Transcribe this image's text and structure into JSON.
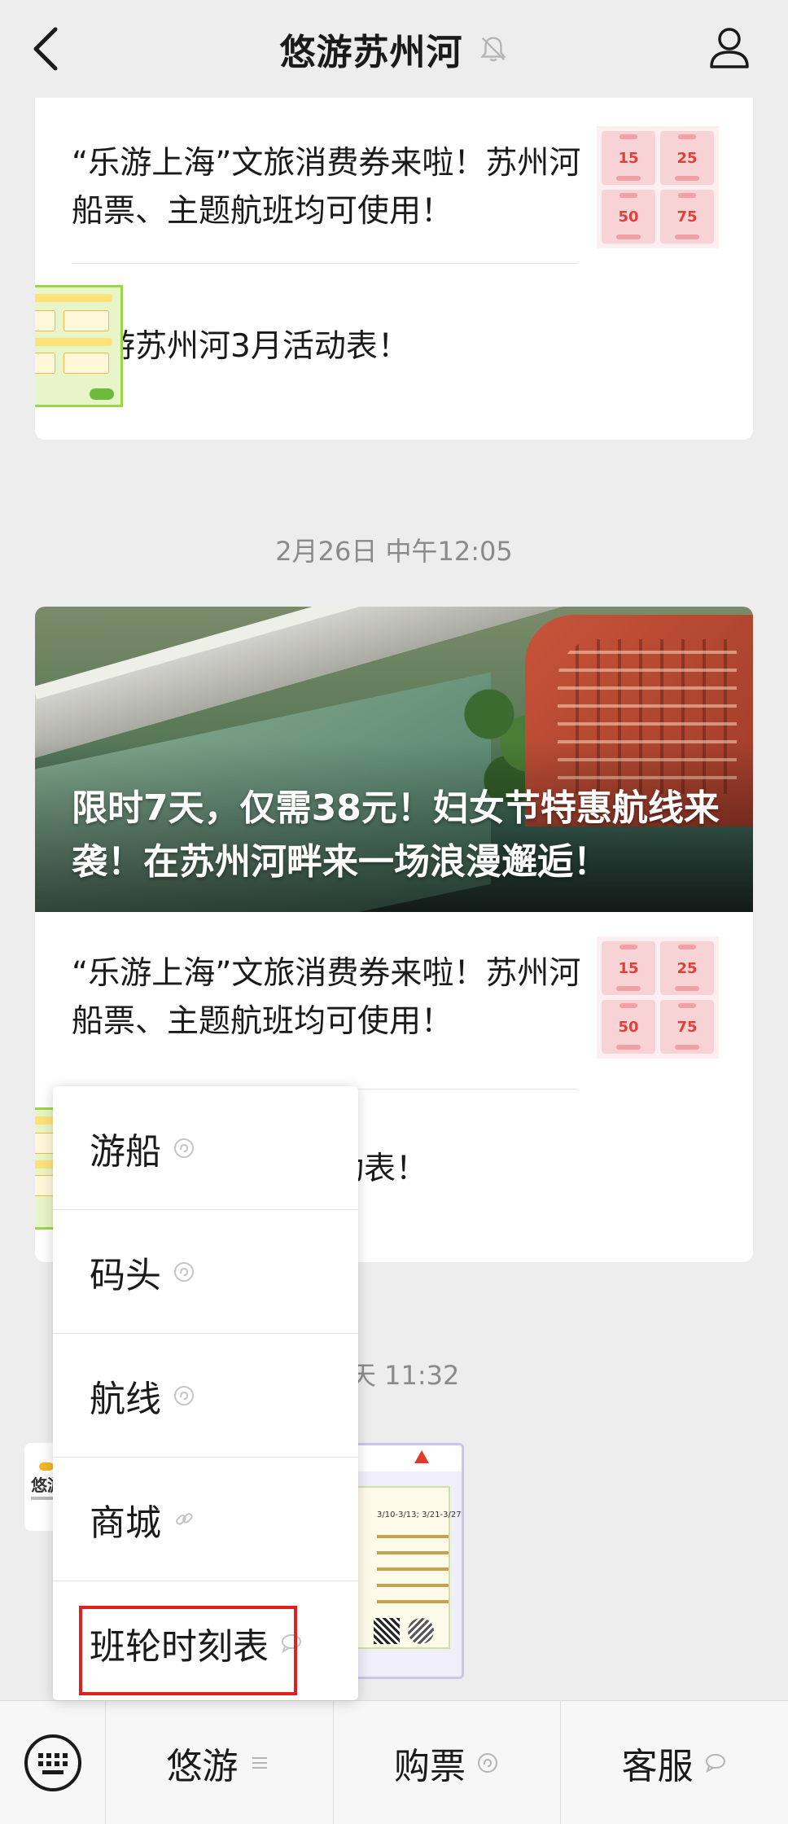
{
  "header": {
    "title": "悠游苏州河",
    "back_icon": "chevron-left-icon",
    "mute_icon": "bell-muted-icon",
    "profile_icon": "person-icon"
  },
  "article_group_1": {
    "items": [
      {
        "title": "“乐游上海”文旅消费券来啦！苏州河船票、主题航班均可使用！",
        "thumb": "coupon"
      },
      {
        "title": "悠游苏州河3月活动表！",
        "thumb": "schedule"
      }
    ]
  },
  "timestamp_1": "2月26日 中午12:05",
  "article_group_2": {
    "banner_title": "限时7天，仅需38元！妇女节特惠航线来袭！在苏州河畔来一场浪漫邂逅！",
    "items": [
      {
        "title": "“乐游上海”文旅消费券来啦！苏州河船票、主题航班均可使用！",
        "thumb": "coupon"
      },
      {
        "title_visible": "动表！",
        "thumb": "schedule"
      }
    ]
  },
  "timestamp_2_visible": "天 11:32",
  "coupon_values": [
    "15",
    "25",
    "50",
    "75"
  ],
  "image_message": {
    "visible_text": "3/10-3/13; 3/21-3/27"
  },
  "popup_menu": {
    "items": [
      {
        "label": "游船",
        "icon": "mini-program-icon"
      },
      {
        "label": "码头",
        "icon": "mini-program-icon"
      },
      {
        "label": "航线",
        "icon": "mini-program-icon"
      },
      {
        "label": "商城",
        "icon": "link-icon"
      },
      {
        "label": "班轮时刻表",
        "icon": "message-icon",
        "highlighted": true
      }
    ],
    "highlight_color": "#e02020"
  },
  "bottom_bar": {
    "keyboard_icon": "keyboard-icon",
    "tabs": [
      {
        "label": "悠游",
        "icon": "menu-lines-icon"
      },
      {
        "label": "购票",
        "icon": "mini-program-icon"
      },
      {
        "label": "客服",
        "icon": "message-icon"
      }
    ]
  }
}
